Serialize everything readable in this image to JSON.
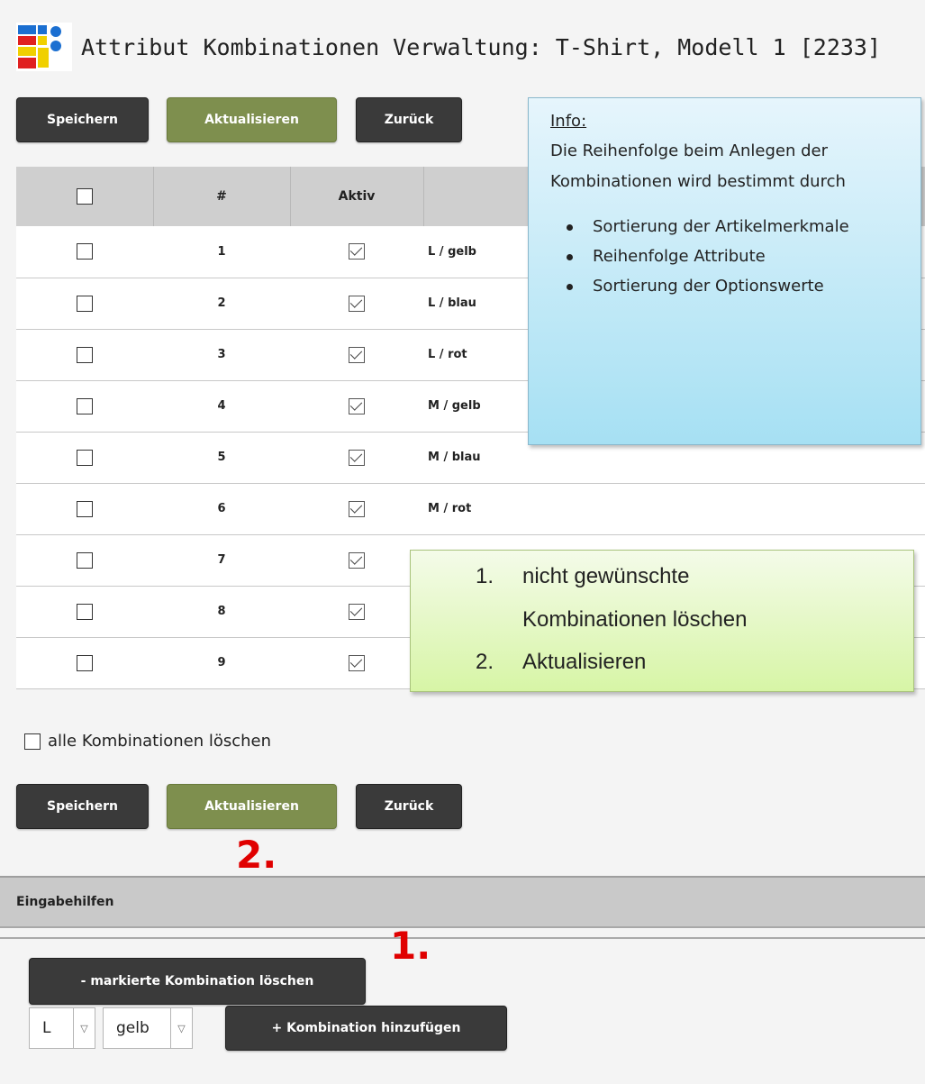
{
  "page": {
    "title": "Attribut Kombinationen Verwaltung: T-Shirt, Modell 1 [2233]"
  },
  "buttons": {
    "save": "Speichern",
    "update": "Aktualisieren",
    "back": "Zurück"
  },
  "table": {
    "headers": [
      "#",
      "Aktiv"
    ],
    "rows": [
      {
        "num": "1",
        "active": true,
        "name": "L / gelb"
      },
      {
        "num": "2",
        "active": true,
        "name": "L / blau"
      },
      {
        "num": "3",
        "active": true,
        "name": "L / rot"
      },
      {
        "num": "4",
        "active": true,
        "name": "M / gelb"
      },
      {
        "num": "5",
        "active": true,
        "name": "M / blau"
      },
      {
        "num": "6",
        "active": true,
        "name": "M / rot"
      },
      {
        "num": "7",
        "active": true,
        "name": ""
      },
      {
        "num": "8",
        "active": true,
        "name": ""
      },
      {
        "num": "9",
        "active": true,
        "name": ""
      }
    ]
  },
  "all_delete_label": "alle Kombinationen löschen",
  "helpers": {
    "section_title": "Eingabehilfen",
    "delete_marked": "- markierte Kombination löschen",
    "add_combination": "+ Kombination hinzufügen",
    "select_size": "L",
    "select_color": "gelb"
  },
  "markers": {
    "step2": "2.",
    "step1": "1."
  },
  "info_box": {
    "title": "Info:",
    "text": "Die Reihenfolge beim Anlegen der Kombinationen wird bestimmt durch",
    "items": [
      "Sortierung der Artikelmerkmale",
      "Reihenfolge Attribute",
      "Sortierung der Optionswerte"
    ]
  },
  "steps_box": {
    "step1_num": "1.",
    "step1_line1": "nicht gewünschte",
    "step1_line2": "Kombinationen löschen",
    "step2_num": "2.",
    "step2_text": "Aktualisieren"
  },
  "colors": {
    "dark_button": "#3a3a3a",
    "green_button": "#7e8f4e",
    "marker_red": "#e00000",
    "info_blue": "#a6e0f3",
    "steps_green": "#d7f5a6"
  }
}
